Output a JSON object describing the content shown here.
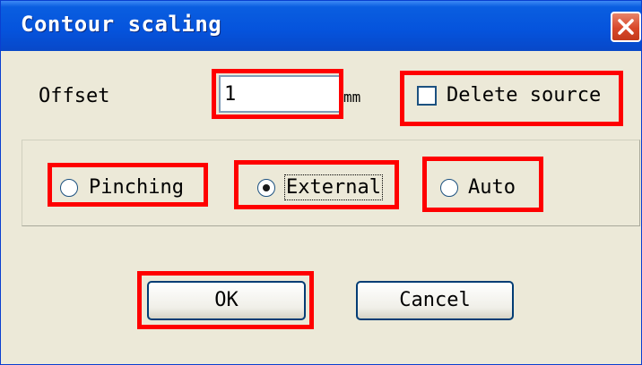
{
  "window": {
    "title": "Contour scaling"
  },
  "offset": {
    "label": "Offset",
    "value": "1",
    "unit": "mm"
  },
  "delete_source": {
    "label": "Delete source",
    "checked": false
  },
  "mode": {
    "options": [
      {
        "label": "Pinching",
        "selected": false
      },
      {
        "label": "External",
        "selected": true
      },
      {
        "label": "Auto",
        "selected": false
      }
    ]
  },
  "buttons": {
    "ok": "OK",
    "cancel": "Cancel"
  },
  "icons": {
    "close": "close-icon"
  },
  "colors": {
    "titlebar": "#0553dc",
    "highlight": "#ff0000",
    "dialog_bg": "#ece9d8"
  }
}
